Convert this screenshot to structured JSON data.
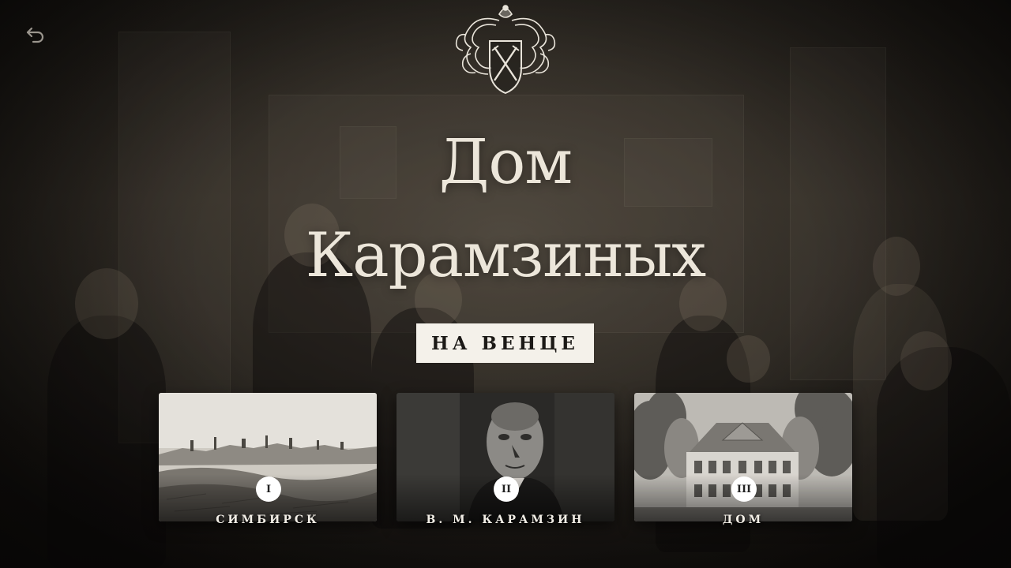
{
  "nav": {
    "back_icon": "undo-arrow-icon"
  },
  "crest": {
    "icon": "coat-of-arms-icon"
  },
  "title": {
    "line1": "Дом",
    "line2": "Карамзиных"
  },
  "subtitle": "НА ВЕНЦЕ",
  "cards": [
    {
      "numeral": "I",
      "label": "СИМБИРСК",
      "image": "city-panorama-engraving"
    },
    {
      "numeral": "II",
      "label": "В. М. КАРАМЗИН",
      "image": "portrait-man"
    },
    {
      "numeral": "III",
      "label": "ДОМ",
      "image": "two-storey-house-trees"
    }
  ],
  "colors": {
    "title": "#ece6da",
    "badge_bg": "#f4f1ea",
    "badge_text": "#1b1916",
    "label": "#f2eee6"
  }
}
